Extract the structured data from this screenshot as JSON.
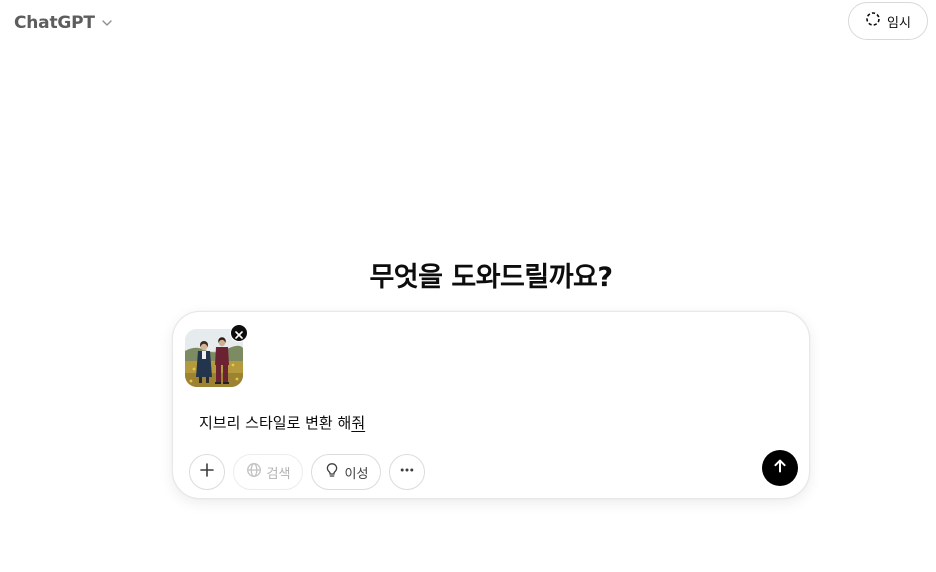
{
  "header": {
    "model_name": "ChatGPT",
    "temporary_label": "임시",
    "icons": {
      "model_dropdown": "chevron-down-icon",
      "temporary": "dashed-circle-icon"
    }
  },
  "main": {
    "headline": "무엇을 도와드릴까요?"
  },
  "composer": {
    "prompt_prefix": "지브리 스타일로 변환 해",
    "prompt_underlined": "줘",
    "attachment": {
      "kind": "image-thumbnail",
      "remove_icon": "close-icon"
    },
    "tools": {
      "add_icon": "plus-icon",
      "search_label": "검색",
      "search_icon": "globe-icon",
      "reason_label": "이성",
      "reason_icon": "lightbulb-icon",
      "more_icon": "more-horizontal-icon"
    },
    "send_icon": "arrow-up-icon"
  },
  "colors": {
    "send_button": "#000000",
    "disabled_text": "#b4b4b4",
    "model_name": "#5d5d5d",
    "border": "#dcdcdc"
  }
}
